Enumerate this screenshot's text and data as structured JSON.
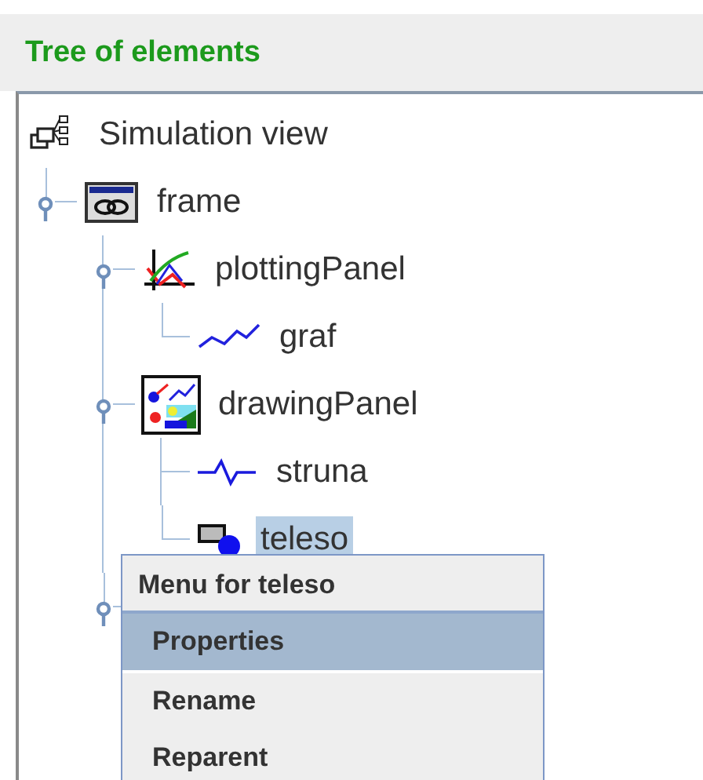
{
  "panel": {
    "title": "Tree of elements"
  },
  "tree": {
    "label": "Simulation view",
    "kind": "view",
    "selected": false,
    "children": [
      {
        "label": "frame",
        "kind": "frame",
        "selected": false,
        "expanded": true,
        "children": [
          {
            "label": "plottingPanel",
            "kind": "plotting-panel",
            "selected": false,
            "expanded": true,
            "children": [
              {
                "label": "graf",
                "kind": "trail",
                "selected": false
              }
            ]
          },
          {
            "label": "drawingPanel",
            "kind": "drawing-panel",
            "selected": false,
            "expanded": true,
            "children": [
              {
                "label": "struna",
                "kind": "spring",
                "selected": false
              },
              {
                "label": "teleso",
                "kind": "shape",
                "selected": true
              }
            ]
          },
          {
            "kind": "hidden",
            "expanded": true
          }
        ]
      }
    ]
  },
  "context_menu": {
    "title": "Menu for teleso",
    "items": [
      {
        "label": "Properties",
        "selected": true
      },
      {
        "label": "Rename",
        "selected": false
      },
      {
        "label": "Reparent",
        "selected": false
      }
    ]
  }
}
